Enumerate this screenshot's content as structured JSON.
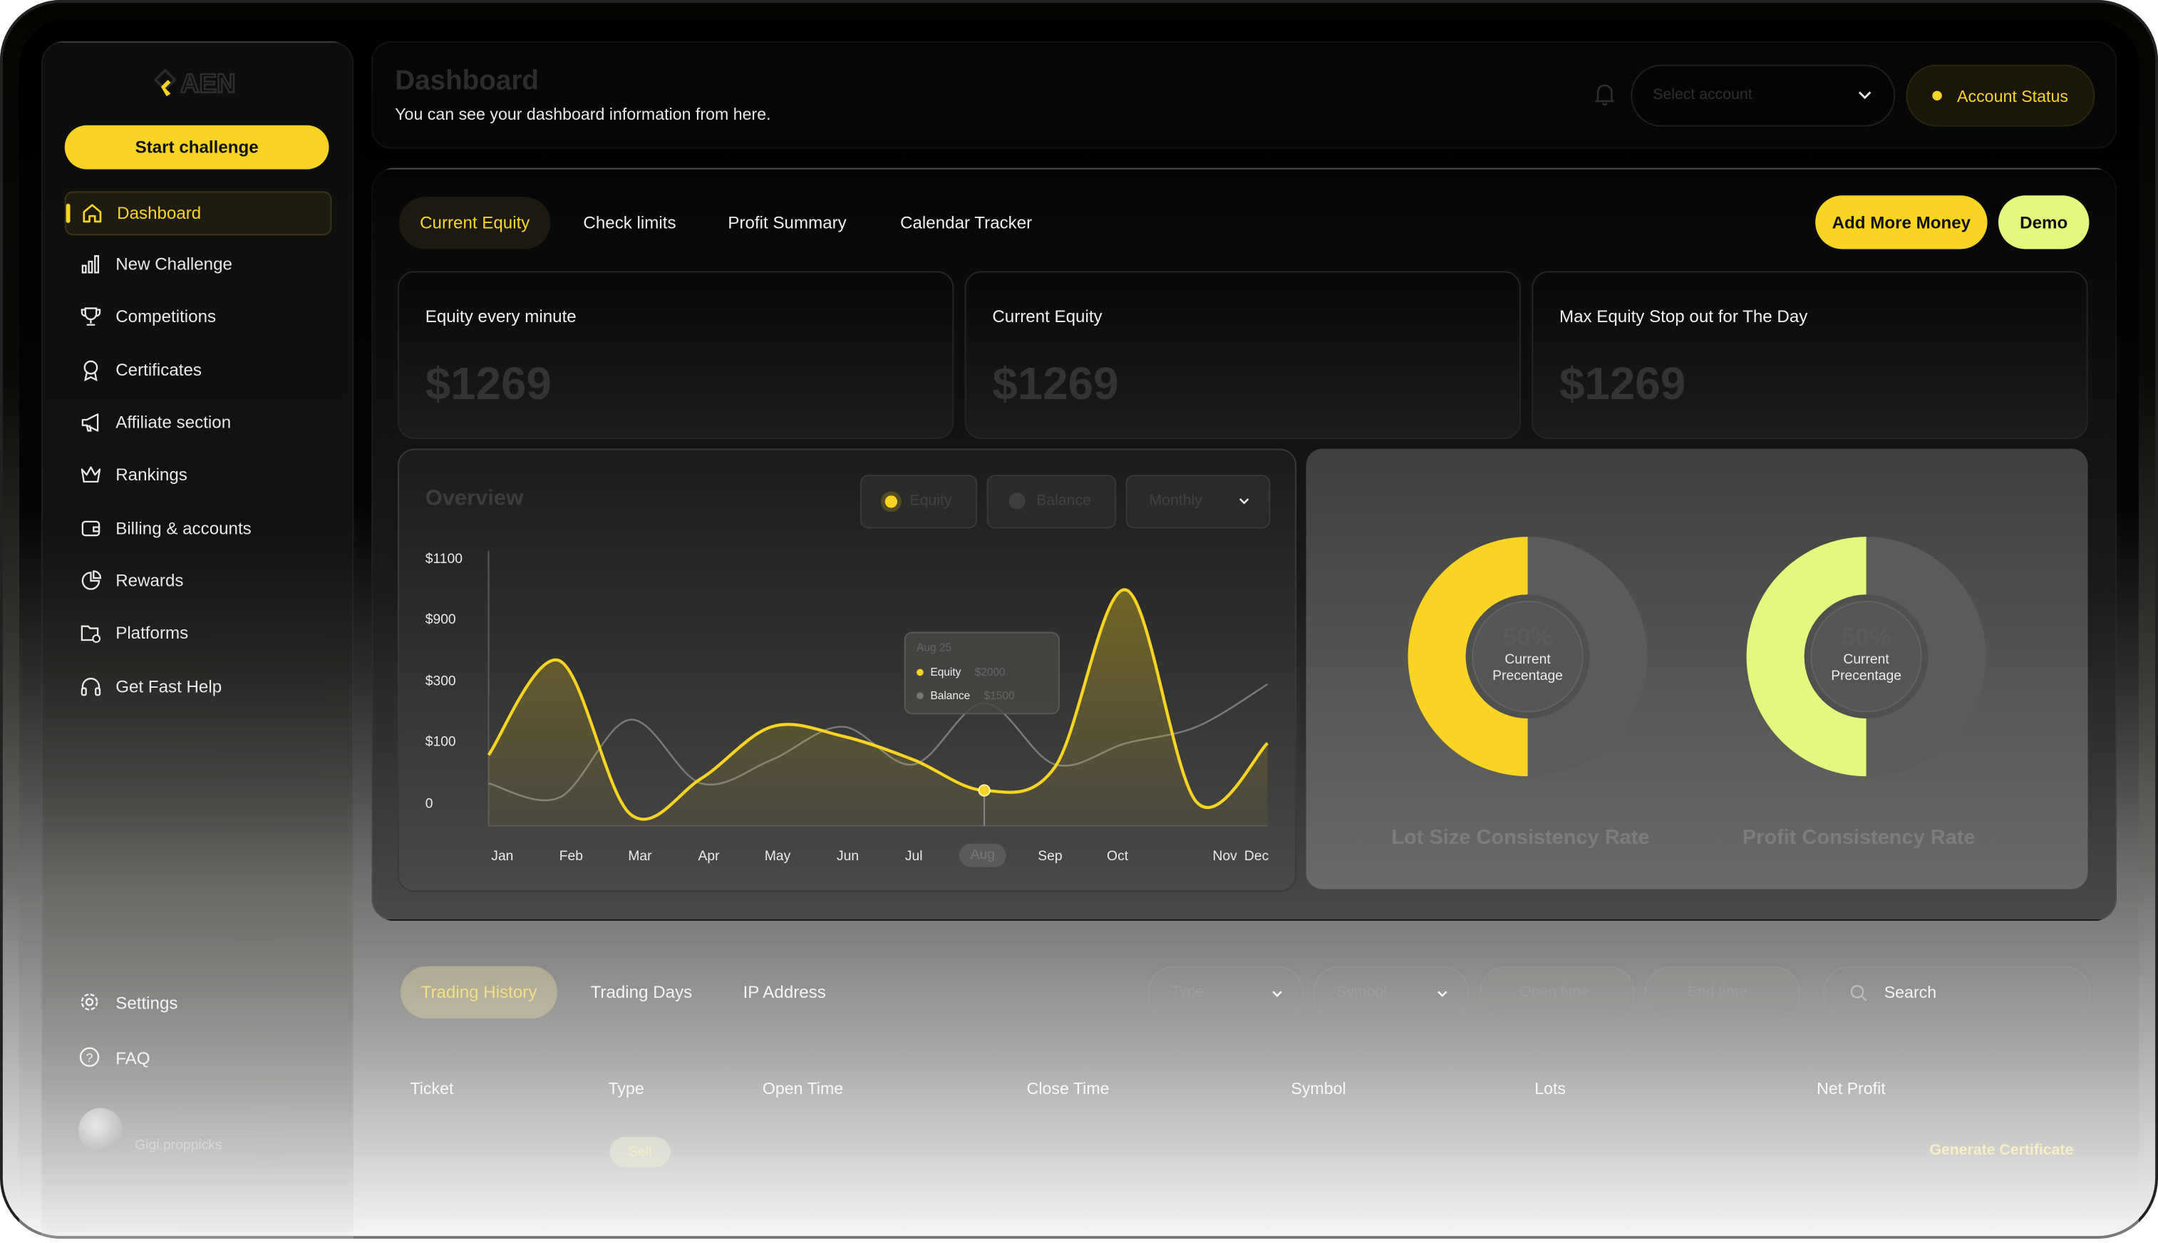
{
  "sidebar": {
    "start_button": "Start challenge",
    "items": [
      {
        "label": "Dashboard",
        "icon": "home-icon"
      },
      {
        "label": "New Challenge",
        "icon": "bar-chart-icon"
      },
      {
        "label": "Competitions",
        "icon": "trophy-icon"
      },
      {
        "label": "Certificates",
        "icon": "award-icon"
      },
      {
        "label": "Affiliate section",
        "icon": "megaphone-icon"
      },
      {
        "label": "Rankings",
        "icon": "crown-icon"
      },
      {
        "label": "Billing & accounts",
        "icon": "wallet-icon"
      },
      {
        "label": "Rewards",
        "icon": "pie-chart-icon"
      },
      {
        "label": "Platforms",
        "icon": "folder-icon"
      },
      {
        "label": "Get Fast Help",
        "icon": "headset-icon"
      }
    ],
    "settings": "Settings",
    "faq": "FAQ",
    "user_name": "Gigi.proppicks"
  },
  "header": {
    "title": "Dashboard",
    "subtitle": "You can see your dashboard information from here.",
    "account_select_placeholder": "Select account",
    "account_status": "Account Status"
  },
  "tabs": [
    "Current Equity",
    "Check limits",
    "Profit Summary",
    "Calendar Tracker"
  ],
  "actions": {
    "add_money": "Add More Money",
    "demo": "Demo"
  },
  "cards": [
    {
      "label": "Equity every minute",
      "value": "$1269"
    },
    {
      "label": "Current Equity",
      "value": "$1269"
    },
    {
      "label": "Max Equity Stop out for The Day",
      "value": "$1269"
    }
  ],
  "overview": {
    "title": "Overview",
    "legend_equity": "Equity",
    "legend_balance": "Balance",
    "period": "Monthly",
    "tooltip": {
      "date": "Aug 25",
      "equity_label": "Equity",
      "equity_value": "$2000",
      "balance_label": "Balance",
      "balance_value": "$1500"
    }
  },
  "chart_data": {
    "type": "area",
    "categories": [
      "Jan",
      "Feb",
      "Mar",
      "Apr",
      "May",
      "Jun",
      "Jul",
      "Aug",
      "Sep",
      "Oct",
      "Nov",
      "Dec"
    ],
    "y_tick_labels": [
      "$1100",
      "$900",
      "$300",
      "$100",
      "0"
    ],
    "series": [
      {
        "name": "Equity",
        "values": [
          300,
          700,
          50,
          200,
          420,
          380,
          280,
          150,
          250,
          1000,
          100,
          350
        ]
      },
      {
        "name": "Balance",
        "values": [
          180,
          120,
          450,
          180,
          280,
          420,
          260,
          520,
          260,
          350,
          420,
          600
        ]
      }
    ],
    "colors": {
      "equity": "#f9d423",
      "balance": "#7a7a78"
    }
  },
  "donuts": [
    {
      "pct": "50%",
      "caption_line1": "Current",
      "caption_line2": "Precentage",
      "label": "Lot Size Consistency Rate",
      "color": "#f9d423",
      "fraction": 0.5
    },
    {
      "pct": "50%",
      "caption_line1": "Current",
      "caption_line2": "Precentage",
      "label": "Profit Consistency Rate",
      "color": "#e5f77c",
      "fraction": 0.5
    }
  ],
  "history": {
    "tabs": [
      "Trading History",
      "Trading Days",
      "IP Address"
    ],
    "filters": {
      "type": "Type",
      "symbol": "Symbol",
      "open_time": "Open time",
      "end_time": "End time",
      "search": "Search"
    },
    "columns": [
      "Ticket",
      "Type",
      "Open Time",
      "Close Time",
      "Symbol",
      "Lots",
      "Net Profit"
    ],
    "row": {
      "type": "Sell",
      "action": "Generate Certificate"
    }
  }
}
